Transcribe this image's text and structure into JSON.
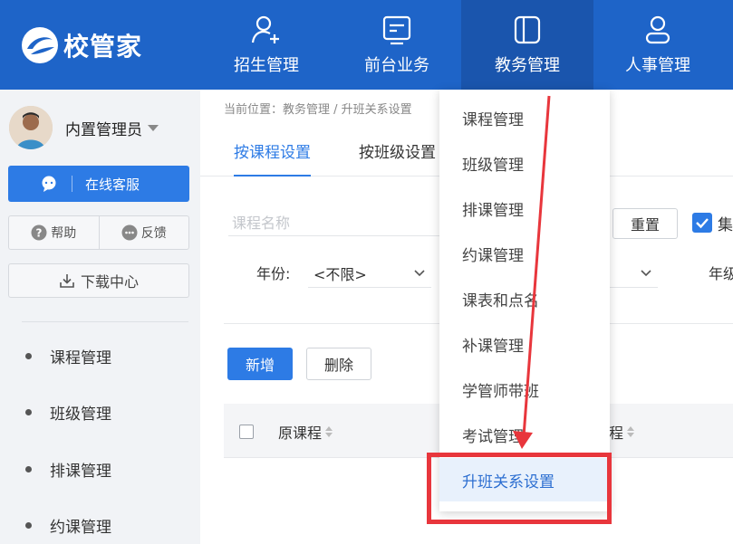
{
  "app": {
    "logo_text": "校管家",
    "accent_color": "#1e64c8"
  },
  "nav": {
    "items": [
      {
        "label": "招生管理",
        "icon": "user-plus-icon"
      },
      {
        "label": "前台业务",
        "icon": "monitor-icon"
      },
      {
        "label": "教务管理",
        "icon": "panel-icon",
        "active": true
      },
      {
        "label": "人事管理",
        "icon": "user-icon"
      }
    ]
  },
  "sidebar": {
    "user_name": "内置管理员",
    "service_label": "在线客服",
    "help_label": "帮助",
    "feedback_label": "反馈",
    "download_label": "下载中心",
    "menu": [
      {
        "label": "课程管理"
      },
      {
        "label": "班级管理"
      },
      {
        "label": "排课管理"
      },
      {
        "label": "约课管理"
      }
    ]
  },
  "main": {
    "breadcrumb": "当前位置：教务管理 / 升班关系设置",
    "tabs": [
      {
        "label": "按课程设置",
        "active": true
      },
      {
        "label": "按班级设置"
      }
    ],
    "filters": {
      "course_name_placeholder": "课程名称",
      "reset_label": "重置",
      "checkbox_label": "集",
      "year_label": "年份:",
      "year_value": "<不限>",
      "grade_label": "年级"
    },
    "actions": {
      "add_label": "新增",
      "delete_label": "删除"
    },
    "table": {
      "col_original": "原课程",
      "col_target": "程"
    }
  },
  "dropdown": {
    "items": [
      {
        "label": "课程管理"
      },
      {
        "label": "班级管理"
      },
      {
        "label": "排课管理"
      },
      {
        "label": "约课管理"
      },
      {
        "label": "课表和点名"
      },
      {
        "label": "补课管理"
      },
      {
        "label": "学管师带班"
      },
      {
        "label": "考试管理"
      },
      {
        "label": "升班关系设置",
        "selected": true
      }
    ]
  },
  "annotation": {
    "box_color": "#e8363c"
  }
}
